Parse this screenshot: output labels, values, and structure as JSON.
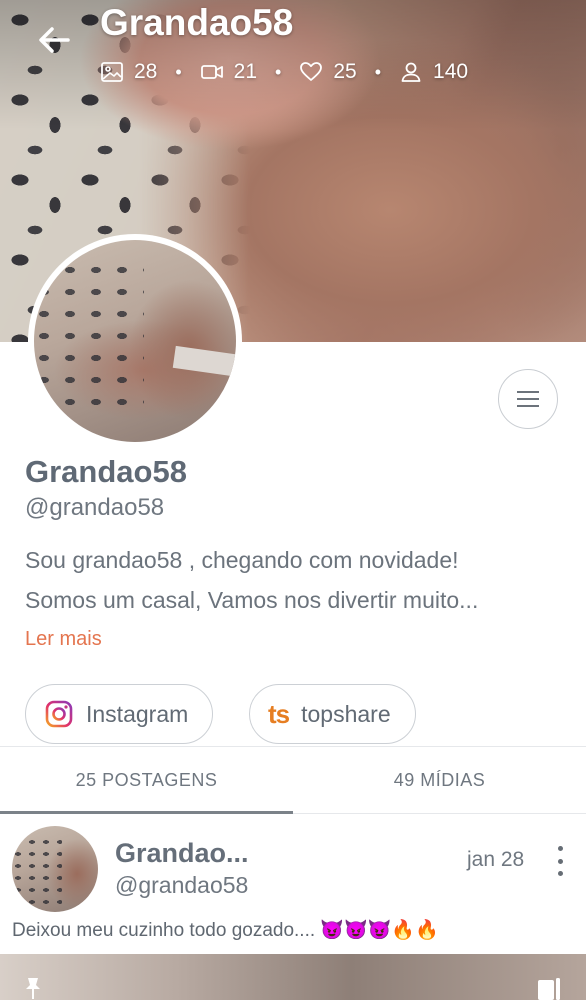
{
  "profile": {
    "cover_title": "Grandao58",
    "stats": {
      "photos": "28",
      "videos": "21",
      "likes": "25",
      "subscribers": "140"
    },
    "name": "Grandao58",
    "handle": "@grandao58",
    "bio_lines": [
      "Sou grandao58 , chegando com novidade!",
      "Somos um casal, Vamos nos divertir muito..."
    ],
    "read_more": "Ler mais"
  },
  "links": [
    {
      "label": "Instagram",
      "icon": "instagram-icon"
    },
    {
      "label": "topshare",
      "icon": "topshare-icon",
      "icon_text": "ts"
    }
  ],
  "tabs": [
    {
      "label": "25 POSTAGENS",
      "active": true
    },
    {
      "label": "49 MÍDIAS",
      "active": false
    }
  ],
  "post": {
    "author_name": "Grandao...",
    "author_handle": "@grandao58",
    "date": "jan 28",
    "text": "Deixou meu cuzinho todo gozado.... 😈😈😈🔥🔥"
  },
  "colors": {
    "accent": "#e4754f",
    "topshare": "#e67e22",
    "text": "#5f6975"
  }
}
